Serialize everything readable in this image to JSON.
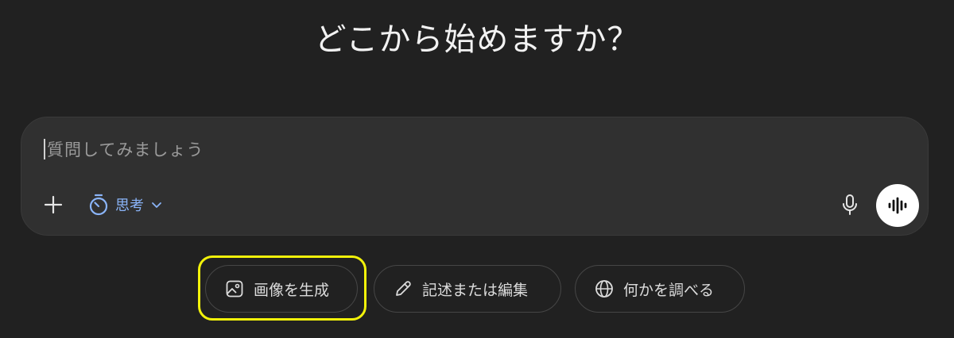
{
  "headline": "どこから始めますか？",
  "composer": {
    "placeholder": "質問してみましょう",
    "tools": {
      "add_icon": "plus-icon",
      "think_icon": "timer-icon",
      "think_label": "思考",
      "dropdown_icon": "chevron-down-icon",
      "mic_icon": "microphone-icon",
      "voice_icon": "waveform-icon"
    }
  },
  "suggestions": [
    {
      "label": "画像を生成",
      "icon": "image-icon"
    },
    {
      "label": "記述または編集",
      "icon": "pencil-icon"
    },
    {
      "label": "何かを調べる",
      "icon": "globe-icon"
    }
  ],
  "colors": {
    "background": "#212121",
    "composer": "#303030",
    "accent_blue": "#8ab4f8",
    "highlight": "#f2f20a"
  }
}
